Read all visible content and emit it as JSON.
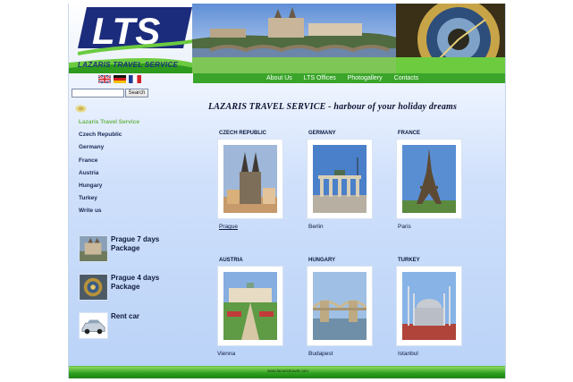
{
  "header": {
    "logo_text": "LTS",
    "tagline": "LAZARIS TRAVEL SERVICE"
  },
  "nav": {
    "items": [
      "About Us",
      "LTS Offices",
      "Photogallery",
      "Contacts"
    ]
  },
  "languages": [
    "english-flag",
    "german-flag",
    "french-flag"
  ],
  "search": {
    "value": "",
    "button_label": "Search"
  },
  "menu": {
    "items": [
      "Lazaris Travel Service",
      "Czech Republic",
      "Germany",
      "France",
      "Austria",
      "Hungary",
      "Turkey",
      "Write us"
    ]
  },
  "packages": [
    {
      "title": "Prague 7 days Package"
    },
    {
      "title": "Prague 4 days Package"
    },
    {
      "title": "Rent car"
    }
  ],
  "headline": "LAZARIS TRAVEL SERVICE  -  harbour of your holiday dreams",
  "countries": [
    {
      "country": "CZECH REPUBLIC",
      "city": "Prague"
    },
    {
      "country": "GERMANY",
      "city": "Berlin"
    },
    {
      "country": "FRANCE",
      "city": "Paris"
    },
    {
      "country": "AUSTRIA",
      "city": "Vienna"
    },
    {
      "country": "HUNGARY",
      "city": "Budapest"
    },
    {
      "country": "TURKEY",
      "city": "Istanbul"
    }
  ],
  "footer": {
    "link": "www.lazarisrtravel.com"
  },
  "colors": {
    "nav_green": "#3aa52a",
    "logo_blue": "#1d2f7a",
    "active_menu": "#6ab64c"
  }
}
